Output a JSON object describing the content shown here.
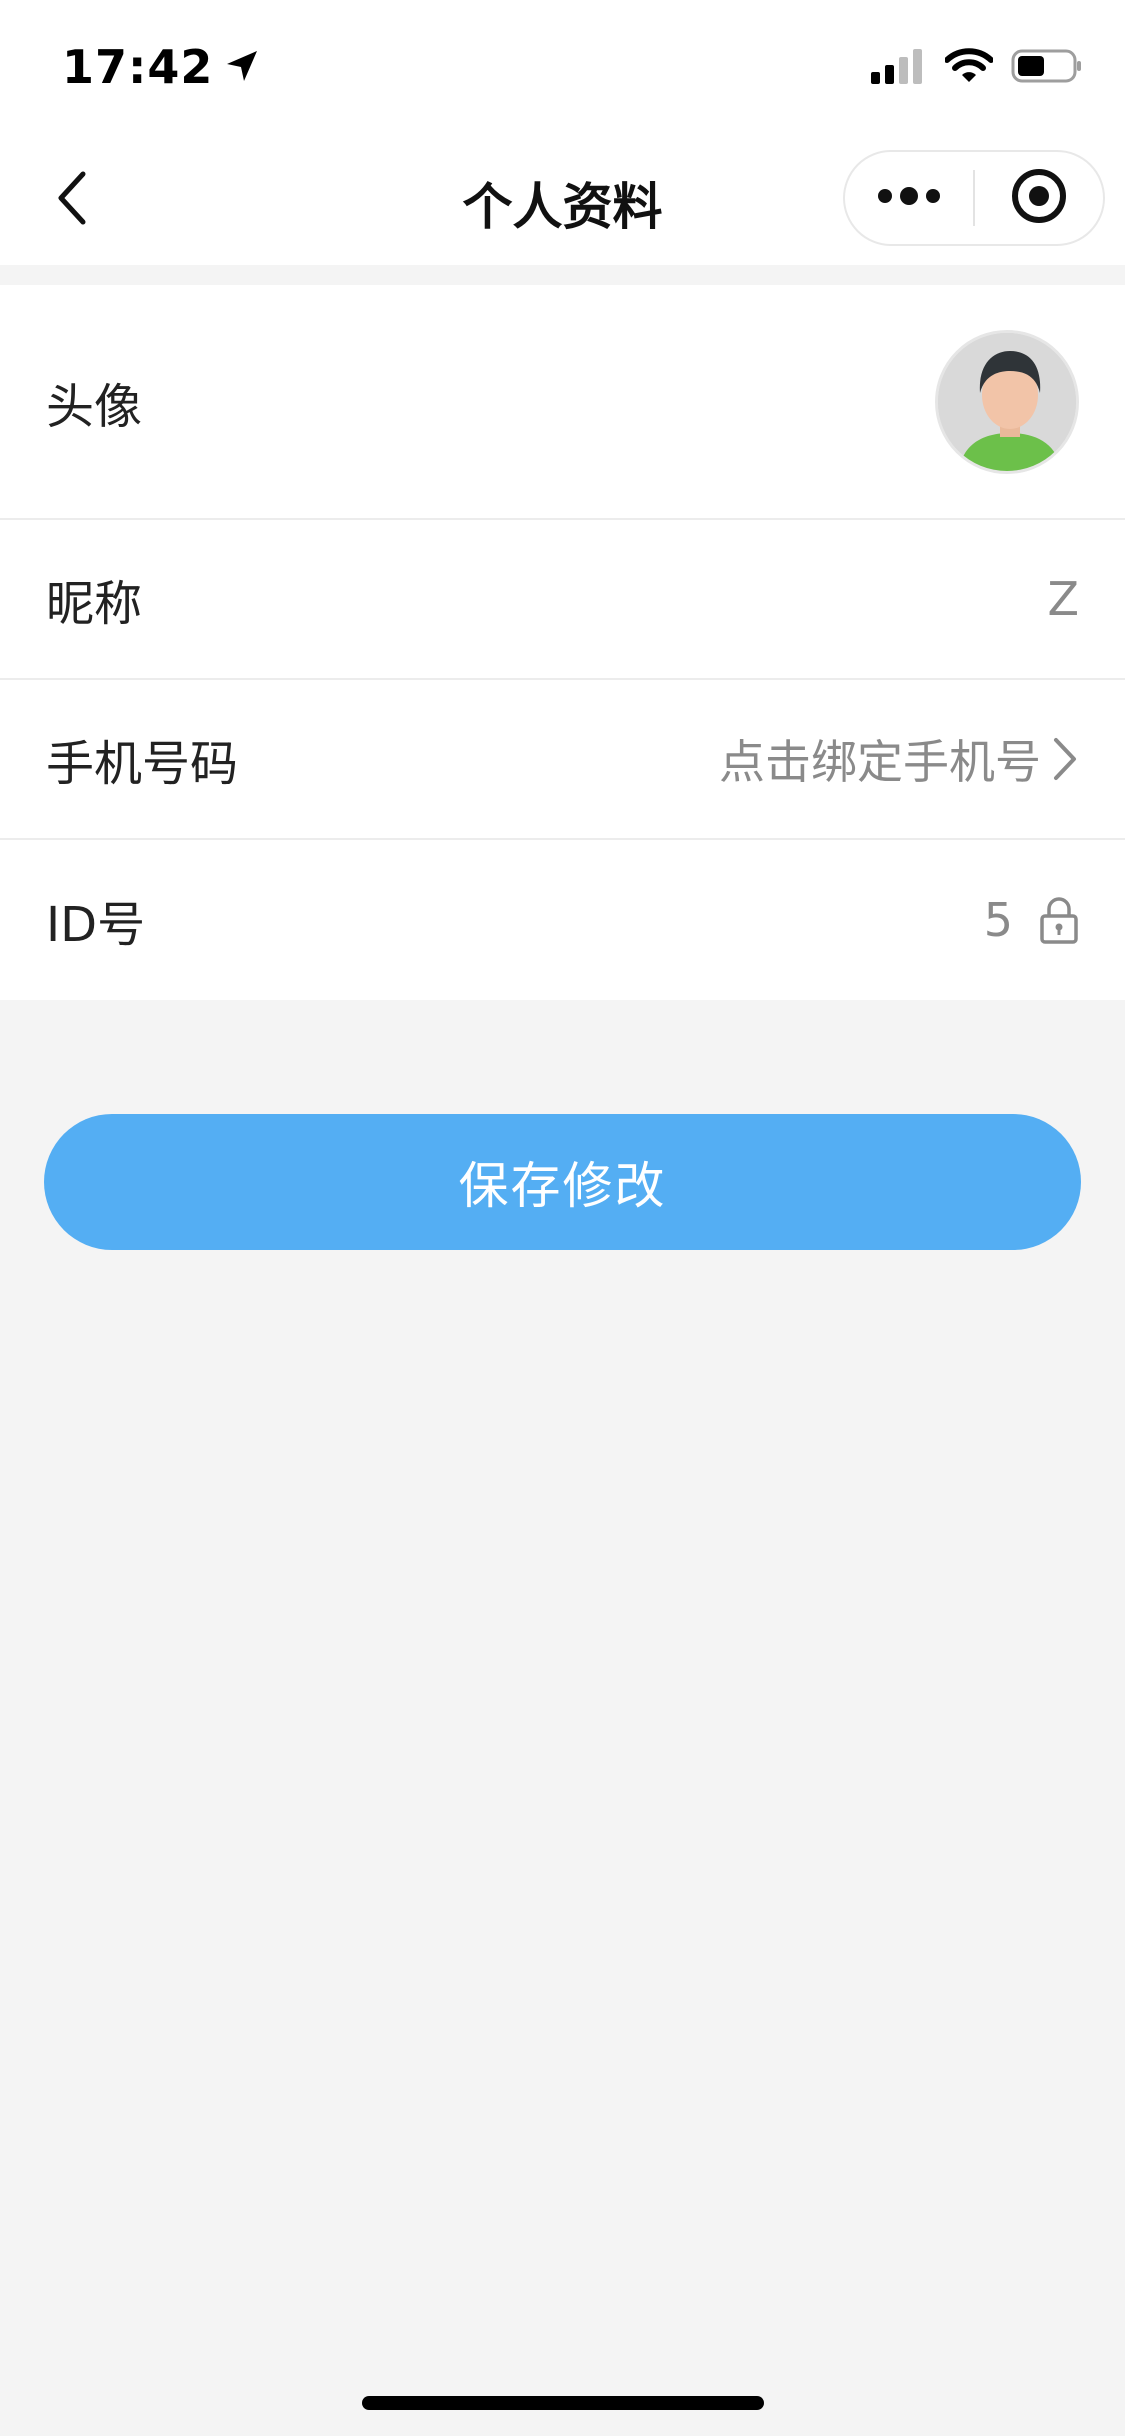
{
  "status_bar": {
    "time": "17:42",
    "icons": [
      "location-arrow-icon",
      "signal-icon",
      "wifi-icon",
      "battery-icon"
    ]
  },
  "nav": {
    "title": "个人资料",
    "icons": [
      "back-chevron-icon",
      "more-dots-icon",
      "close-target-icon"
    ]
  },
  "profile": {
    "rows": [
      {
        "label": "头像",
        "value": "",
        "type": "avatar"
      },
      {
        "label": "昵称",
        "value": "Z",
        "type": "text"
      },
      {
        "label": "手机号码",
        "value": "点击绑定手机号",
        "type": "link",
        "icon": "chevron-right-icon"
      },
      {
        "label": "ID号",
        "value": "5",
        "type": "locked",
        "icon": "lock-icon"
      }
    ]
  },
  "actions": {
    "save_label": "保存修改"
  },
  "colors": {
    "accent": "#54aef3",
    "background": "#f4f4f4",
    "avatar_shirt": "#6cc04a"
  }
}
